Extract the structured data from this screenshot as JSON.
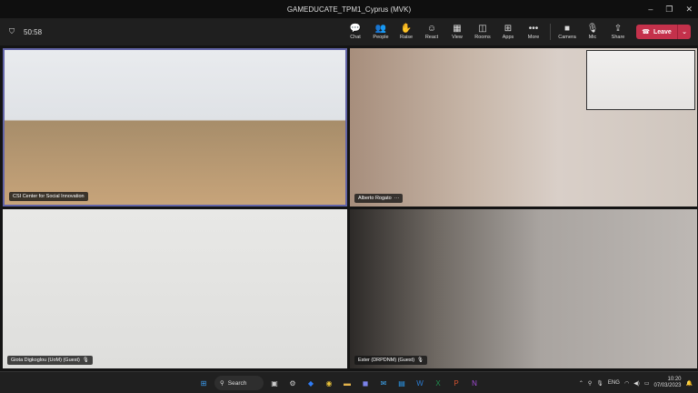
{
  "window": {
    "title": "GAMEDUCATE_TPM1_Cyprus (MVK)"
  },
  "meeting": {
    "timer": "50:58"
  },
  "toolbar": {
    "chat": "Chat",
    "people": "People",
    "raise": "Raise",
    "react": "React",
    "view": "View",
    "rooms": "Rooms",
    "apps": "Apps",
    "more": "More",
    "camera": "Camera",
    "mic": "Mic",
    "share": "Share",
    "leave": "Leave"
  },
  "participants": [
    {
      "name": "CSI Center for Social Innovation"
    },
    {
      "name": "Alberto Rogato"
    },
    {
      "name": "Giota Digkoglou (UoM) (Guest)"
    },
    {
      "name": "Ester (DRPDNM) (Guest)"
    }
  ],
  "taskbar": {
    "search_label": "Search",
    "language": "ENG",
    "time": "10:20",
    "date": "07/03/2023"
  },
  "colors": {
    "accent": "#6264a7",
    "leave": "#c4314b"
  }
}
